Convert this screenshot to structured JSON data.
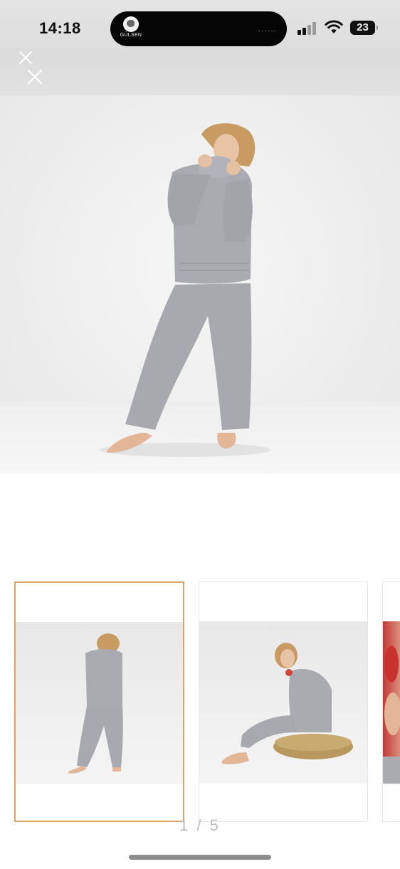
{
  "status_bar": {
    "time": "14:18",
    "battery_level": "23",
    "island_brand": "GÜLSEN",
    "island_dots": "······",
    "signal_icon": "cellular-signal-icon",
    "wifi_icon": "wifi-icon",
    "battery_icon": "battery-icon"
  },
  "gallery": {
    "close_icon": "close-icon",
    "pager": "1 / 5",
    "selected_index": 1,
    "total": 5,
    "main_image": "model-grey-knit-turtleneck-set-standing",
    "thumbnails": [
      {
        "subject": "model-grey-knit-set-standing",
        "active": true
      },
      {
        "subject": "model-grey-knit-set-seated-on-pouf",
        "active": false
      },
      {
        "subject": "model-closeup-partial",
        "active": false
      }
    ]
  },
  "colors": {
    "active_thumb_border": "#d9a46a",
    "knit_grey": "#a9abb0",
    "backdrop": "#eeeeee"
  }
}
